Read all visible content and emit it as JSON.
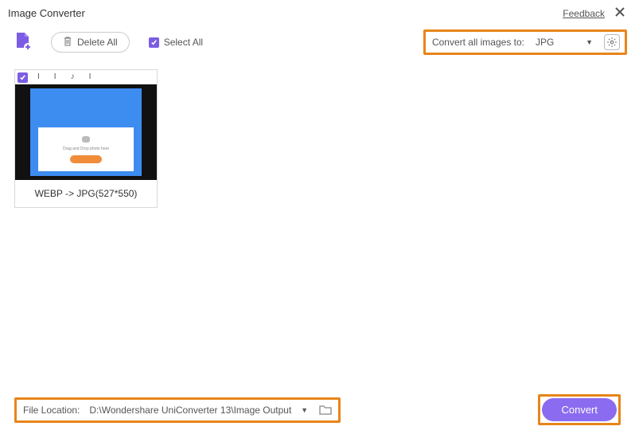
{
  "header": {
    "title": "Image Converter",
    "feedback": "Feedback"
  },
  "toolbar": {
    "delete_all": "Delete All",
    "select_all": "Select All",
    "convert_label": "Convert all images to:",
    "selected_format": "JPG"
  },
  "items": [
    {
      "label": "WEBP -> JPG(527*550)",
      "inner_text": "Drag and Drop photo here"
    }
  ],
  "footer": {
    "file_location_label": "File Location:",
    "file_location_path": "D:\\Wondershare UniConverter 13\\Image Output",
    "convert": "Convert"
  }
}
